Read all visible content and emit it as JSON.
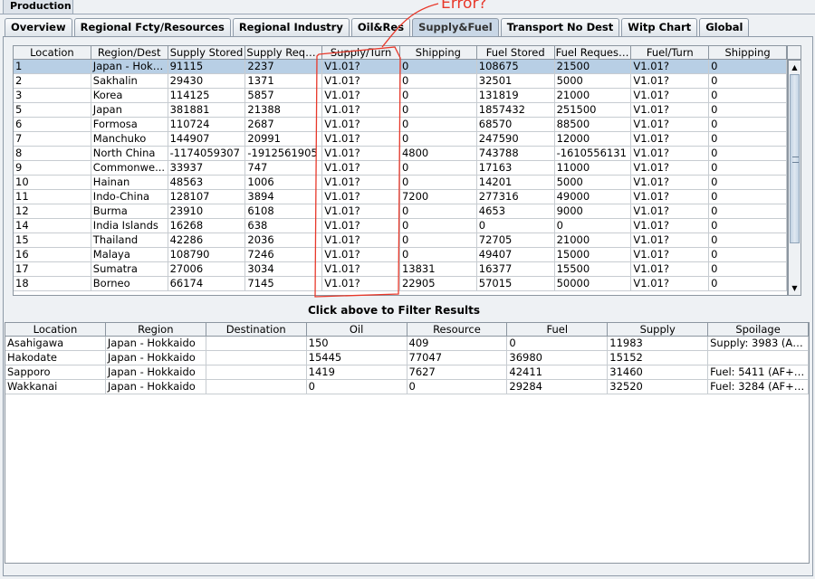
{
  "window": {
    "title": "Production"
  },
  "tabs": [
    {
      "label": "Overview"
    },
    {
      "label": "Regional Fcty/Resources"
    },
    {
      "label": "Regional Industry"
    },
    {
      "label": "Oil&Res"
    },
    {
      "label": "Supply&Fuel",
      "active": true
    },
    {
      "label": "Transport No Dest"
    },
    {
      "label": "Witp Chart"
    },
    {
      "label": "Global"
    }
  ],
  "annotation": {
    "text": "Error?",
    "color": "#e8382a"
  },
  "main_table": {
    "columns": [
      "Location",
      "Region/Dest",
      "Supply Stored",
      "Supply Requ...",
      "Supply/Turn",
      "Shipping",
      "Fuel Stored",
      "Fuel Request...",
      "Fuel/Turn",
      "Shipping"
    ],
    "rows": [
      [
        "1",
        "Japan - Hokk...",
        "91115",
        "2237",
        "V1.01?",
        "0",
        "108675",
        "21500",
        "V1.01?",
        "0"
      ],
      [
        "2",
        "Sakhalin",
        "29430",
        "1371",
        "V1.01?",
        "0",
        "32501",
        "5000",
        "V1.01?",
        "0"
      ],
      [
        "3",
        "Korea",
        "114125",
        "5857",
        "V1.01?",
        "0",
        "131819",
        "21000",
        "V1.01?",
        "0"
      ],
      [
        "5",
        "Japan",
        "381881",
        "21388",
        "V1.01?",
        "0",
        "1857432",
        "251500",
        "V1.01?",
        "0"
      ],
      [
        "6",
        "Formosa",
        "110724",
        "2687",
        "V1.01?",
        "0",
        "68570",
        "88500",
        "V1.01?",
        "0"
      ],
      [
        "7",
        "Manchuko",
        "144907",
        "20991",
        "V1.01?",
        "0",
        "247590",
        "12000",
        "V1.01?",
        "0"
      ],
      [
        "8",
        "North China",
        "-1174059307",
        "-1912561905",
        "V1.01?",
        "4800",
        "743788",
        "-1610556131",
        "V1.01?",
        "0"
      ],
      [
        "9",
        "Commonwe...",
        "33937",
        "747",
        "V1.01?",
        "0",
        "17163",
        "11000",
        "V1.01?",
        "0"
      ],
      [
        "10",
        "Hainan",
        "48563",
        "1006",
        "V1.01?",
        "0",
        "14201",
        "5000",
        "V1.01?",
        "0"
      ],
      [
        "11",
        "Indo-China",
        "128107",
        "3894",
        "V1.01?",
        "7200",
        "277316",
        "49000",
        "V1.01?",
        "0"
      ],
      [
        "12",
        "Burma",
        "23910",
        "6108",
        "V1.01?",
        "0",
        "4653",
        "9000",
        "V1.01?",
        "0"
      ],
      [
        "14",
        "India Islands",
        "16268",
        "638",
        "V1.01?",
        "0",
        "0",
        "0",
        "V1.01?",
        "0"
      ],
      [
        "15",
        "Thailand",
        "42286",
        "2036",
        "V1.01?",
        "0",
        "72705",
        "21000",
        "V1.01?",
        "0"
      ],
      [
        "16",
        "Malaya",
        "108790",
        "7246",
        "V1.01?",
        "0",
        "49407",
        "15000",
        "V1.01?",
        "0"
      ],
      [
        "17",
        "Sumatra",
        "27006",
        "3034",
        "V1.01?",
        "13831",
        "16377",
        "15500",
        "V1.01?",
        "0"
      ],
      [
        "18",
        "Borneo",
        "66174",
        "7145",
        "V1.01?",
        "22905",
        "57015",
        "50000",
        "V1.01?",
        "0"
      ]
    ]
  },
  "filter_label": "Click above to Filter Results",
  "detail_table": {
    "columns": [
      "Location",
      "Region",
      "Destination",
      "Oil",
      "Resource",
      "Fuel",
      "Supply",
      "Spoilage"
    ],
    "rows": [
      [
        "Asahigawa",
        "Japan - Hokkaido",
        "",
        "150",
        "409",
        "0",
        "11983",
        "Supply: 3983 (AF+..."
      ],
      [
        "Hakodate",
        "Japan - Hokkaido",
        "",
        "15445",
        "77047",
        "36980",
        "15152",
        ""
      ],
      [
        "Sapporo",
        "Japan - Hokkaido",
        "",
        "1419",
        "7627",
        "42411",
        "31460",
        "Fuel: 5411 (AF+P..."
      ],
      [
        "Wakkanai",
        "Japan - Hokkaido",
        "",
        "0",
        "0",
        "29284",
        "32520",
        "Fuel: 3284 (AF+P..."
      ]
    ]
  }
}
